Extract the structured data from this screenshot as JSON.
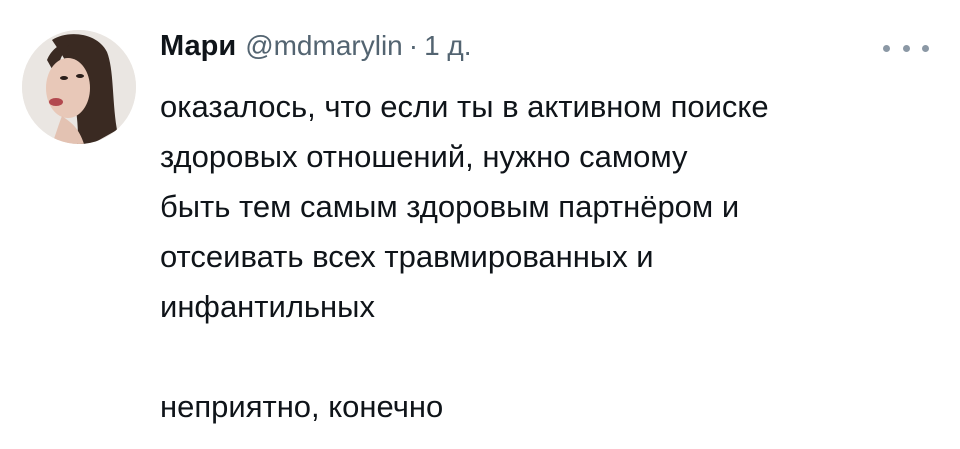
{
  "tweet": {
    "author_name": "Мари",
    "handle": "@mdmarylin",
    "separator": "·",
    "time": "1 д.",
    "lines": [
      "оказалось, что если ты в активном поиске",
      "здоровых отношений, нужно самому",
      "быть тем самым здоровым партнёром и",
      "отсеивать всех травмированных и",
      "инфантильных",
      "",
      "неприятно, конечно"
    ],
    "icons": {
      "avatar": "profile-photo",
      "more": "more-horizontal-icon"
    },
    "colors": {
      "text": "#0f1419",
      "secondary": "#536471",
      "background": "#ffffff"
    }
  }
}
